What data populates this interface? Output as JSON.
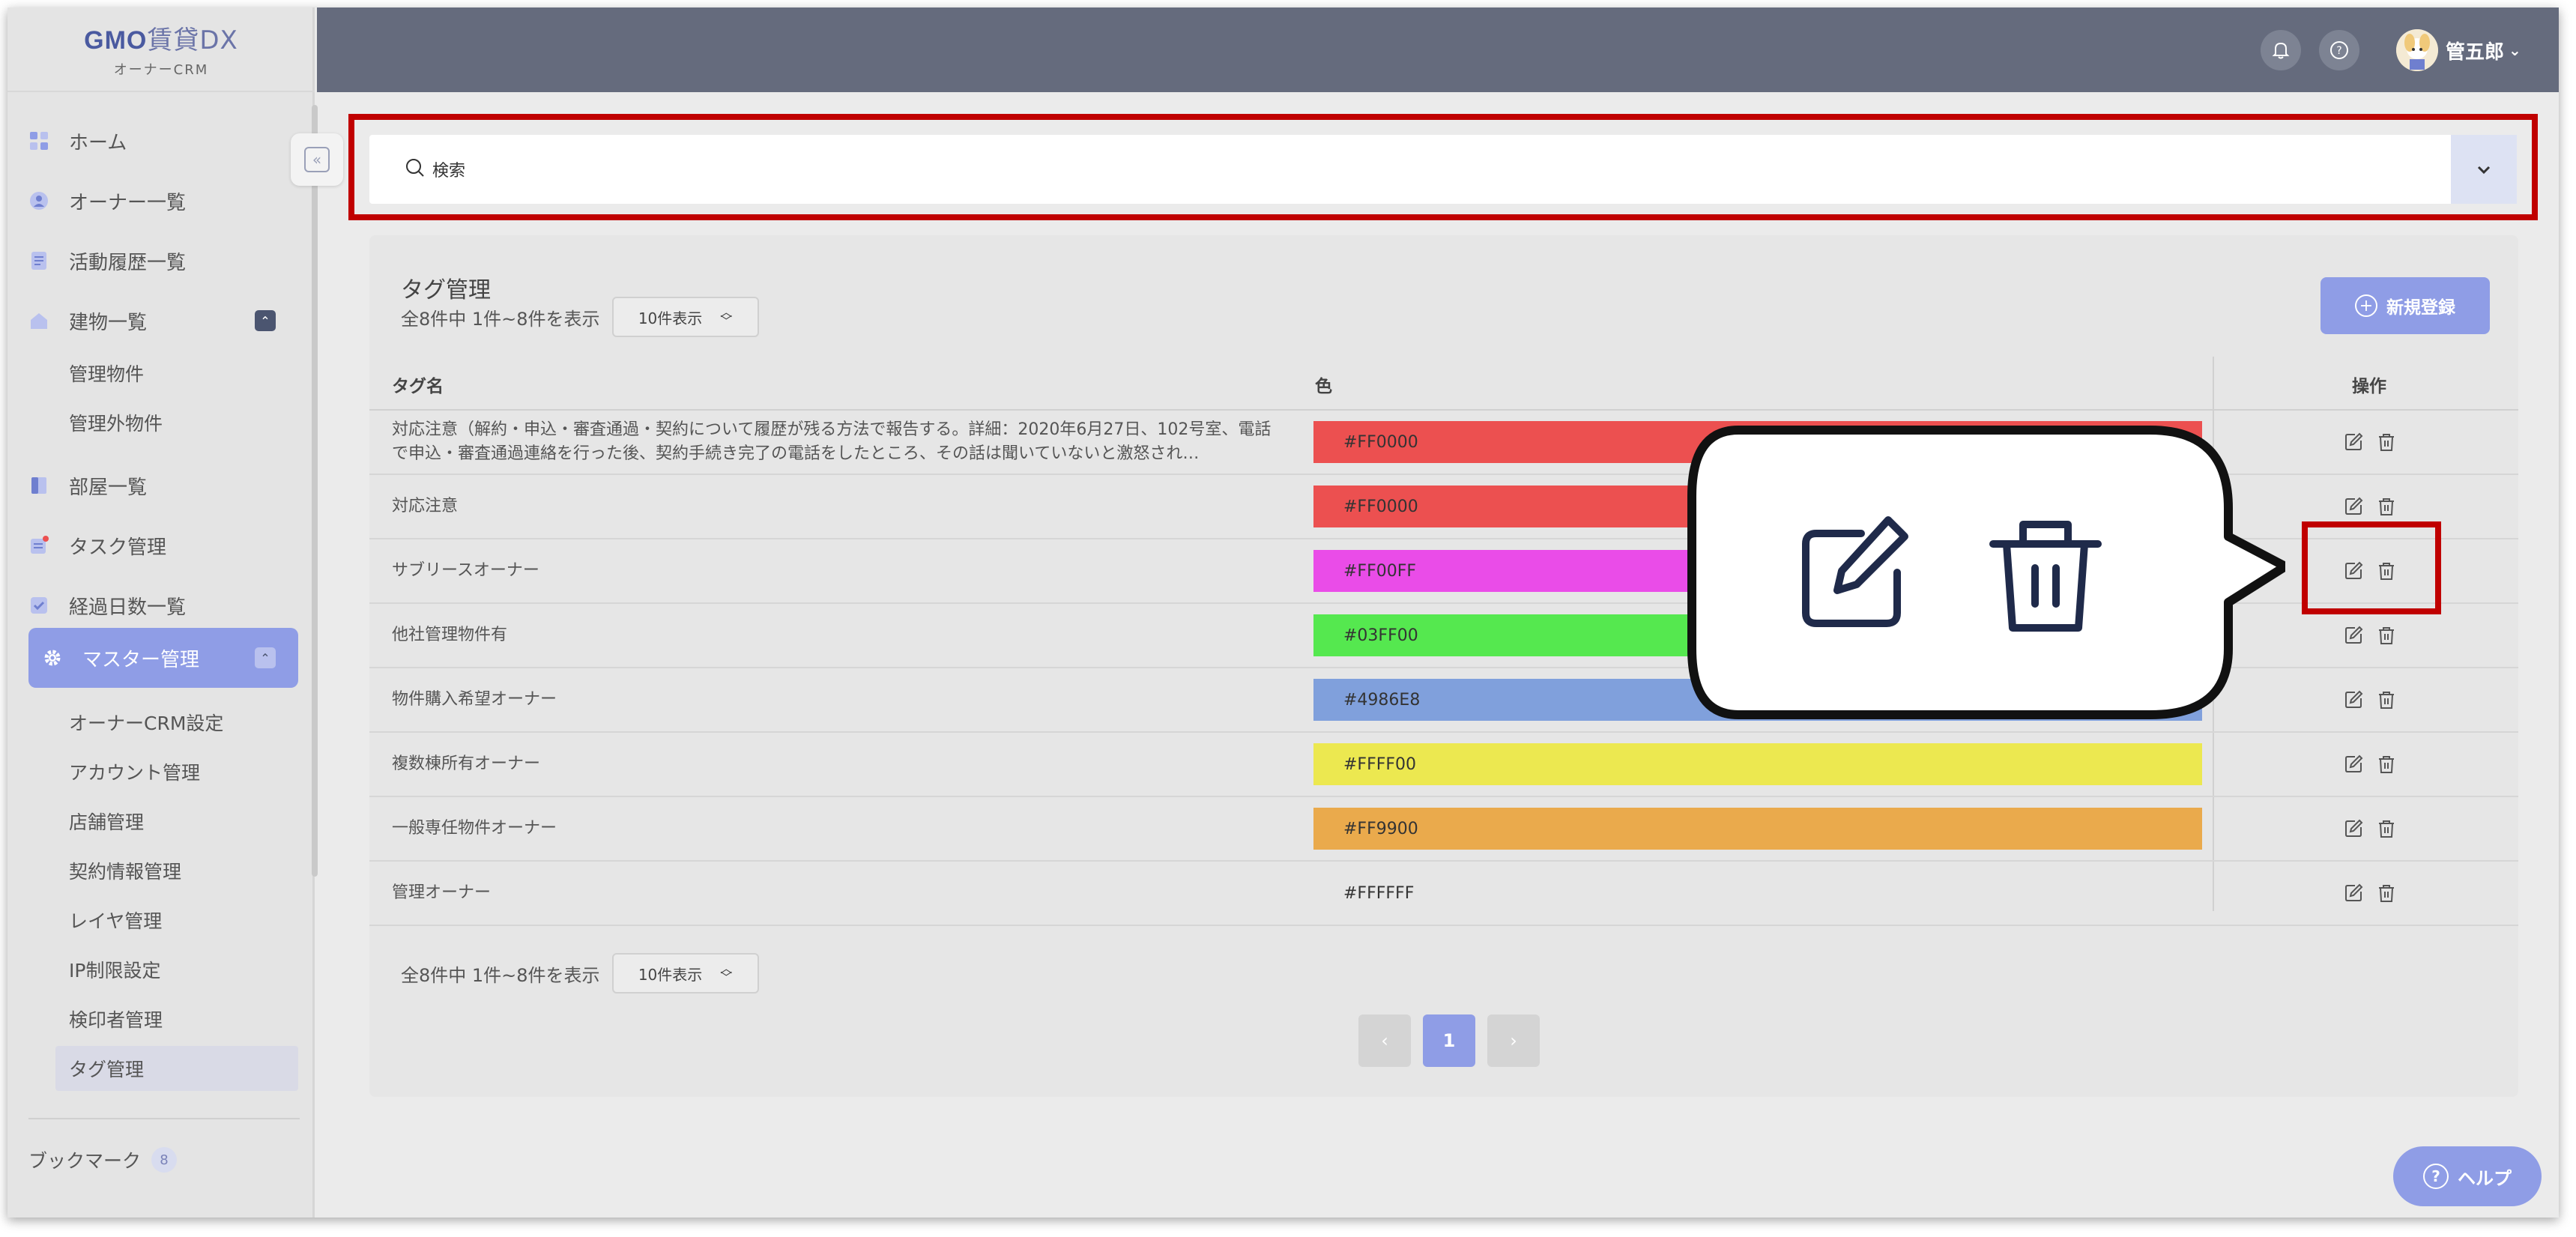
{
  "logo": {
    "brand_gmo": "GMO",
    "brand_rest": "賃貸DX",
    "sub": "オーナーCRM"
  },
  "sidebar": {
    "items": [
      {
        "label": "ホーム"
      },
      {
        "label": "オーナー一覧"
      },
      {
        "label": "活動履歴一覧"
      },
      {
        "label": "建物一覧"
      },
      {
        "label": "部屋一覧"
      },
      {
        "label": "タスク管理"
      },
      {
        "label": "経過日数一覧"
      },
      {
        "label": "マスター管理"
      }
    ],
    "building_sub": [
      "管理物件",
      "管理外物件"
    ],
    "master_sub": [
      "オーナーCRM設定",
      "アカウント管理",
      "店舗管理",
      "契約情報管理",
      "レイヤ管理",
      "IP制限設定",
      "検印者管理",
      "タグ管理"
    ],
    "bookmark_label": "ブックマーク",
    "bookmark_count": "8"
  },
  "header": {
    "user_name": "管五郎"
  },
  "search": {
    "label": "検索"
  },
  "panel": {
    "title": "タグ管理",
    "count_text": "全8件中 1件~8件を表示",
    "per_page": "10件表示",
    "new_button": "新規登録"
  },
  "table": {
    "columns": {
      "name": "タグ名",
      "color": "色",
      "ops": "操作"
    },
    "rows": [
      {
        "name": "対応注意（解約・申込・審査通過・契約について履歴が残る方法で報告する。詳細：2020年6月27日、102号室、電話で申込・審査通過連絡を行った後、契約手続き完了の電話をしたところ、その話は聞いていないと激怒され…",
        "color": "#FF0000",
        "swatch": "#ec5050"
      },
      {
        "name": "対応注意",
        "color": "#FF0000",
        "swatch": "#ec5050"
      },
      {
        "name": "サブリースオーナー",
        "color": "#FF00FF",
        "swatch": "#ea4ce8"
      },
      {
        "name": "他社管理物件有",
        "color": "#03FF00",
        "swatch": "#55e84f"
      },
      {
        "name": "物件購入希望オーナー",
        "color": "#4986E8",
        "swatch": "#80a0dc"
      },
      {
        "name": "複数棟所有オーナー",
        "color": "#FFFF00",
        "swatch": "#ece850"
      },
      {
        "name": "一般専任物件オーナー",
        "color": "#FF9900",
        "swatch": "#eaaa4c"
      },
      {
        "name": "管理オーナー",
        "color": "#FFFFFF",
        "swatch": "#e6e6e6"
      }
    ]
  },
  "pagination": {
    "current": "1",
    "prev": "‹",
    "next": "›"
  },
  "help": {
    "label": "ヘルプ"
  },
  "icons": {
    "edit": "edit-icon",
    "delete": "trash-icon"
  }
}
